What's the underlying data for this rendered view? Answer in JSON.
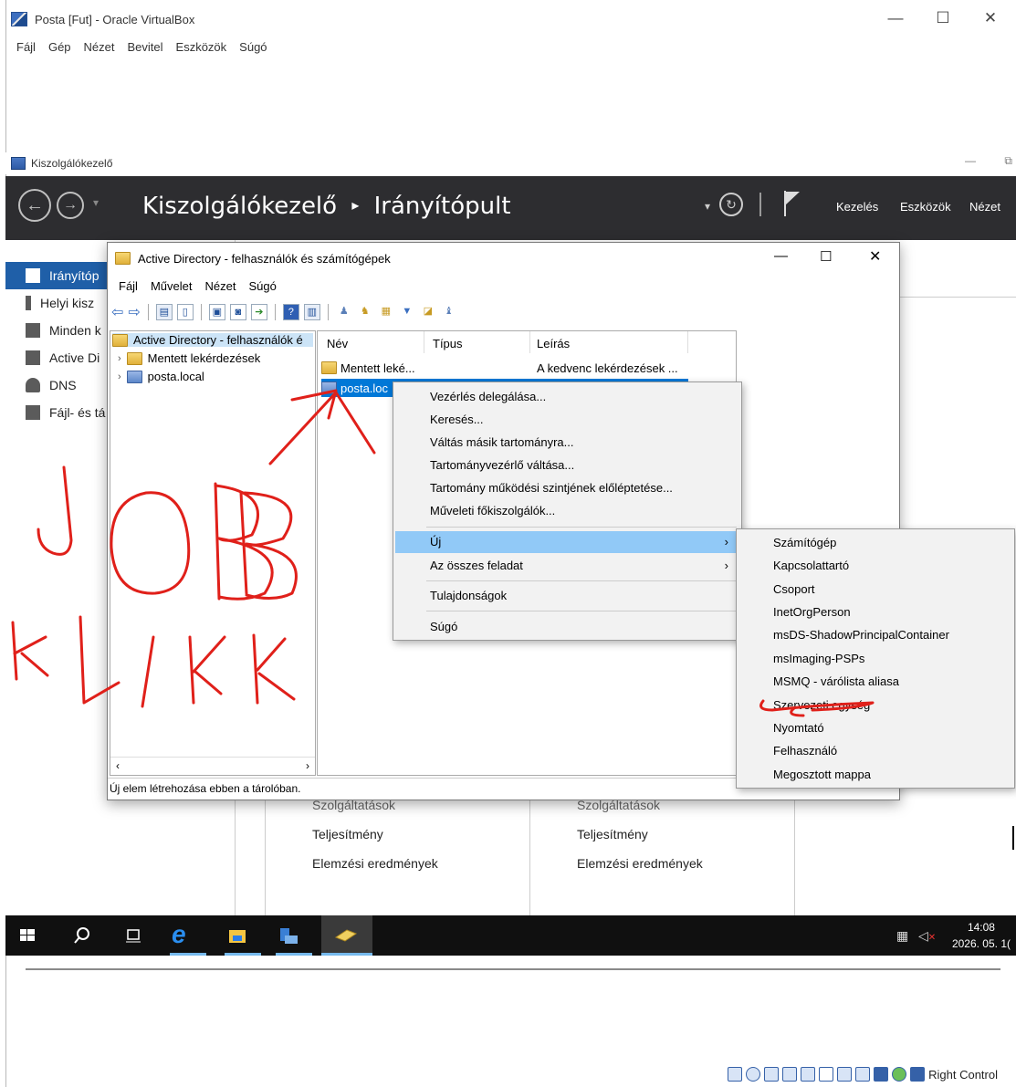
{
  "vbox": {
    "title": "Posta [Fut] - Oracle VirtualBox",
    "menu": [
      "Fájl",
      "Gép",
      "Nézet",
      "Bevitel",
      "Eszközök",
      "Súgó"
    ],
    "status_host_key": "Right Control"
  },
  "server_manager": {
    "window_title": "Kiszolgálókezelő",
    "breadcrumb_root": "Kiszolgálókezelő",
    "breadcrumb_sep": "▸",
    "breadcrumb_page": "Irányítópult",
    "toolbar": {
      "manage": "Kezelés",
      "tools": "Eszközök",
      "view": "Nézet"
    },
    "sidebar": [
      "Irányítóp",
      "Helyi kisz",
      "Minden k",
      "Active Di",
      "DNS",
      "Fájl- és tá"
    ],
    "tiles_left": [
      "Szolgáltatások",
      "Teljesítmény",
      "Elemzési eredmények"
    ],
    "tiles_right": [
      "Szolgáltatások",
      "Teljesítmény",
      "Elemzési eredmények"
    ]
  },
  "ad": {
    "title": "Active Directory - felhasználók és számítógépek",
    "menu": [
      "Fájl",
      "Művelet",
      "Nézet",
      "Súgó"
    ],
    "tree_root": "Active Directory - felhasználók é",
    "tree_items": [
      "Mentett lekérdezések",
      "posta.local"
    ],
    "columns": [
      "Név",
      "Típus",
      "Leírás"
    ],
    "rows": [
      {
        "name": "Mentett leké...",
        "type": "",
        "desc": "A kedvenc lekérdezések ..."
      },
      {
        "name": "posta.loc",
        "type": "",
        "desc": ""
      }
    ],
    "status": "Új elem létrehozása ebben a tárolóban."
  },
  "context_menu": {
    "items": [
      "Vezérlés delegálása...",
      "Keresés...",
      "Váltás másik tartományra...",
      "Tartományvezérlő váltása...",
      "Tartomány működési szintjének előléptetése...",
      "Műveleti főkiszolgálók...",
      "Új",
      "Az összes feladat",
      "Tulajdonságok",
      "Súgó"
    ],
    "submenu_arrow": "›"
  },
  "submenu": {
    "items": [
      "Számítógép",
      "Kapcsolattartó",
      "Csoport",
      "InetOrgPerson",
      "msDS-ShadowPrincipalContainer",
      "msImaging-PSPs",
      "MSMQ - várólista aliasa",
      "Szervezeti egység",
      "Nyomtató",
      "Felhasználó",
      "Megosztott mappa"
    ]
  },
  "taskbar": {
    "time": "14:08",
    "date": "2026. 05. 1("
  },
  "colors": {
    "highlight": "#91c9f7",
    "annotation": "#e0201a",
    "header": "#2d2d30"
  }
}
